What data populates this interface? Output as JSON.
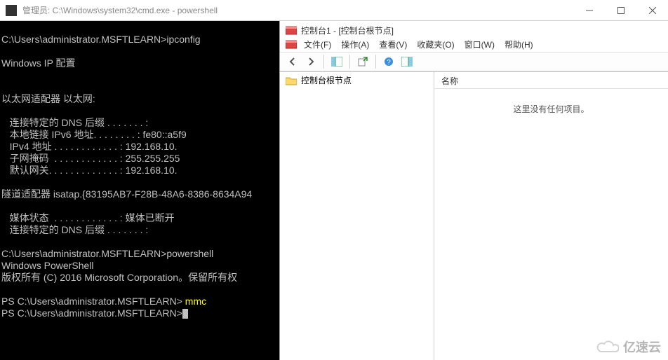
{
  "window": {
    "title": "管理员: C:\\Windows\\system32\\cmd.exe - powershell"
  },
  "console": {
    "lines": [
      "C:\\Users\\administrator.MSFTLEARN>ipconfig",
      "",
      "Windows IP 配置",
      "",
      "",
      "以太网适配器 以太网:",
      "",
      "   连接特定的 DNS 后缀 . . . . . . . :",
      "   本地链接 IPv6 地址. . . . . . . . : fe80::a5f9",
      "   IPv4 地址 . . . . . . . . . . . . : 192.168.10.",
      "   子网掩码  . . . . . . . . . . . . : 255.255.255",
      "   默认网关. . . . . . . . . . . . . : 192.168.10.",
      "",
      "隧道适配器 isatap.{83195AB7-F28B-48A6-8386-8634A94",
      "",
      "   媒体状态  . . . . . . . . . . . . : 媒体已断开",
      "   连接特定的 DNS 后缀 . . . . . . . :",
      "",
      "C:\\Users\\administrator.MSFTLEARN>powershell",
      "Windows PowerShell",
      "版权所有 (C) 2016 Microsoft Corporation。保留所有权",
      "",
      "PS C:\\Users\\administrator.MSFTLEARN> mmc",
      "PS C:\\Users\\administrator.MSFTLEARN>"
    ],
    "cmd_ipconfig": "ipconfig",
    "cmd_powershell": "powershell",
    "cmd_mmc": "mmc"
  },
  "mmc": {
    "title": "控制台1 - [控制台根节点]",
    "menu": {
      "file": "文件(F)",
      "action": "操作(A)",
      "view": "查看(V)",
      "favorites": "收藏夹(O)",
      "window": "窗口(W)",
      "help": "帮助(H)"
    },
    "toolbar": {
      "back": "back",
      "forward": "forward",
      "showhide": "showhide",
      "export": "export",
      "help": "help",
      "details": "details"
    },
    "tree": {
      "root": "控制台根节点"
    },
    "detail": {
      "header": "名称",
      "empty": "这里没有任何项目。"
    }
  },
  "watermark": {
    "text": "亿速云"
  }
}
